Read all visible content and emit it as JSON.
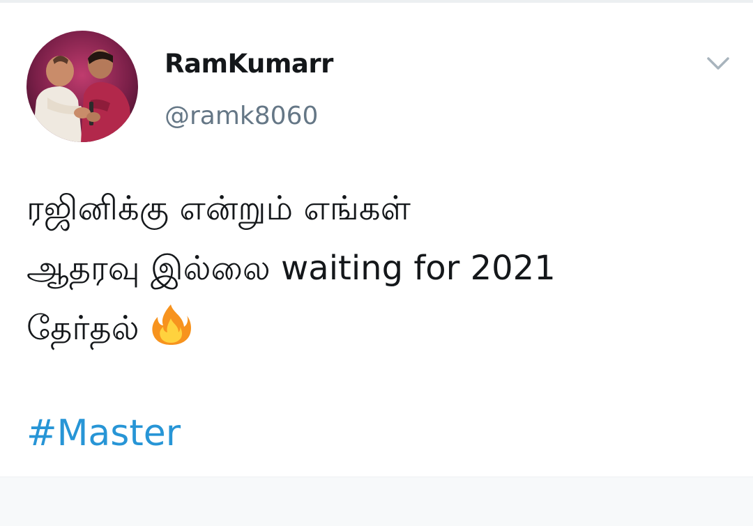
{
  "tweet": {
    "display_name": "RamKumarr",
    "handle": "@ramk8060",
    "text_lines": [
      "ரஜினிக்கு என்றும் எங்கள்",
      "ஆதரவு இல்லை waiting for 2021",
      "தேர்தல்"
    ],
    "emoji": "fire-emoji",
    "hashtag": "#Master"
  },
  "icons": {
    "avatar": "profile-photo",
    "menu": "chevron-down-icon"
  },
  "colors": {
    "name": "#14171a",
    "handle": "#657786",
    "hashtag": "#2795d6",
    "caret": "#a8b4bd"
  }
}
